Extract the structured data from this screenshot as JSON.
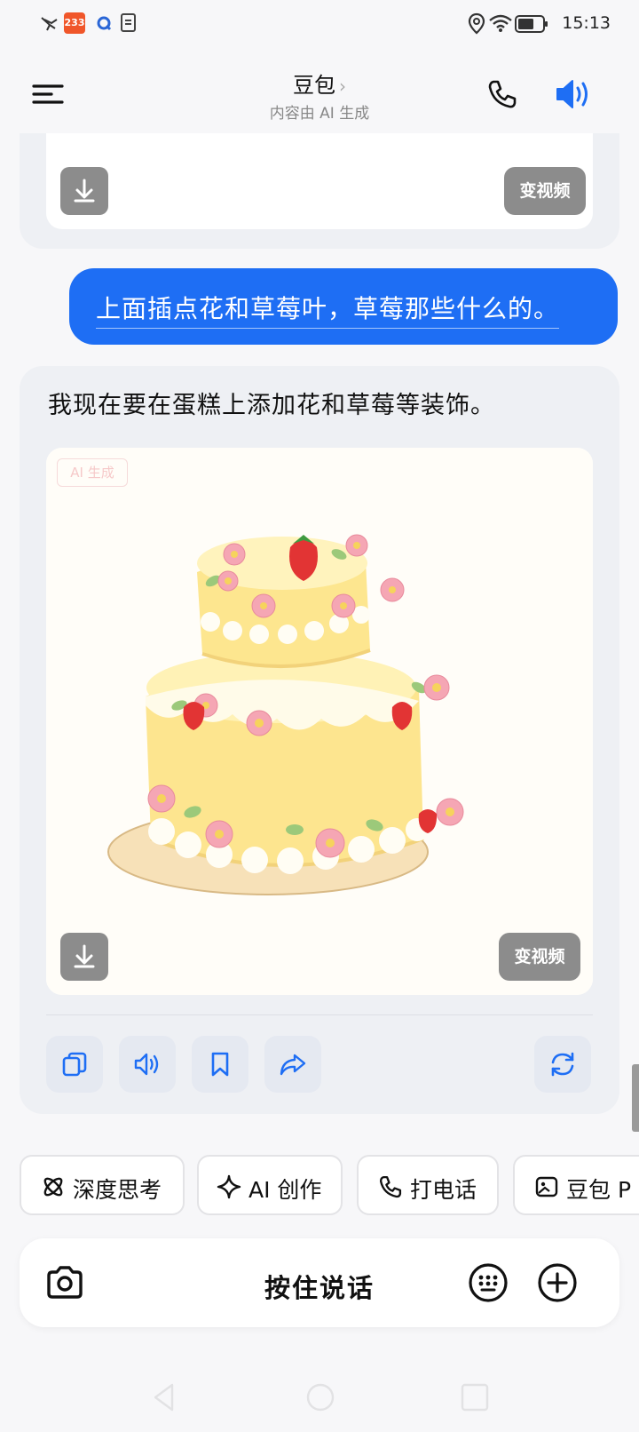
{
  "status_bar": {
    "time": "15:13",
    "notification_badge": "233",
    "icons": [
      "bird-icon",
      "app-233-icon",
      "q-app-icon",
      "document-icon",
      "location-icon",
      "wifi-icon",
      "battery-icon"
    ]
  },
  "header": {
    "title": "豆包",
    "chevron": "›",
    "subtitle": "内容由 AI 生成"
  },
  "prev_card": {
    "video_button": "变视频"
  },
  "user_message": {
    "text": "上面插点花和草莓叶，草莓那些什么的。"
  },
  "assistant": {
    "text": "我现在要在蛋糕上添加花和草莓等装饰。",
    "image": {
      "badge": "AI 生成",
      "subject": "two-tier yellow cake with strawberries and pink flowers"
    },
    "video_button": "变视频"
  },
  "actions": [
    "copy-icon",
    "speaker-icon",
    "bookmark-icon",
    "share-icon",
    "refresh-icon"
  ],
  "chips": [
    {
      "label": "深度思考",
      "icon": "atom-icon"
    },
    {
      "label": "AI 创作",
      "icon": "sparkle-icon"
    },
    {
      "label": "打电话",
      "icon": "phone-icon"
    },
    {
      "label": "豆包 P",
      "icon": "image-edit-icon"
    }
  ],
  "input": {
    "hold_to_talk": "按住说话"
  },
  "colors": {
    "accent": "#1e6ef4",
    "background": "#f7f7f9",
    "card": "#eef0f4"
  }
}
